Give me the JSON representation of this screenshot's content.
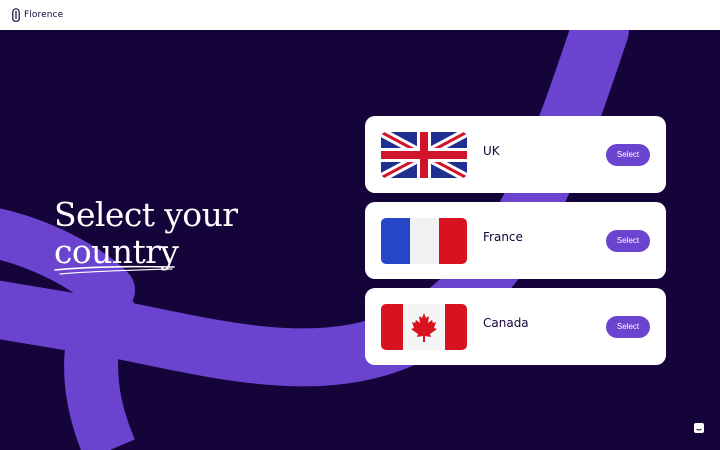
{
  "brand": {
    "name": "Florence",
    "logo_icon": "florence-logo-icon"
  },
  "hero": {
    "headline_line1": "Select your",
    "headline_line2": "country",
    "background_color": "#14043a",
    "swoosh_color": "#6a44cf"
  },
  "countries": [
    {
      "name": "UK",
      "flag": "uk-flag-icon",
      "button_label": "Select"
    },
    {
      "name": "France",
      "flag": "france-flag-icon",
      "button_label": "Select"
    },
    {
      "name": "Canada",
      "flag": "canada-flag-icon",
      "button_label": "Select"
    }
  ],
  "chat": {
    "icon": "chat-icon"
  },
  "colors": {
    "accent": "#6a44cf",
    "navy": "#14043a",
    "card": "#ffffff"
  }
}
